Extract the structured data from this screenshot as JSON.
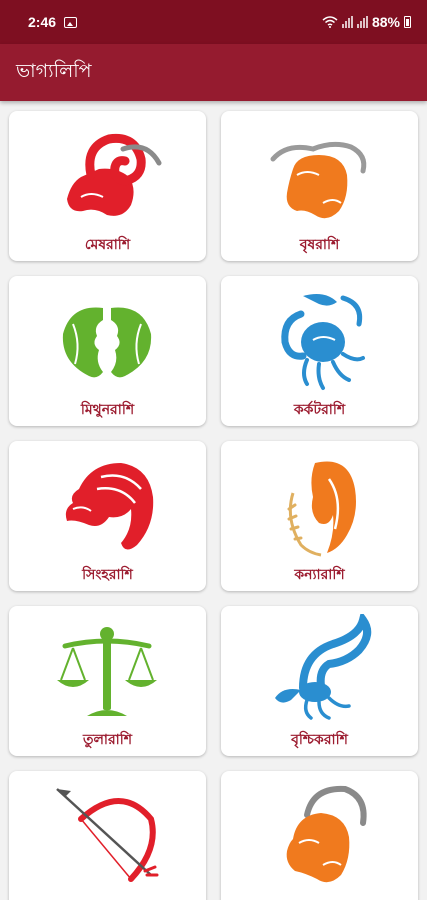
{
  "status_bar": {
    "time": "2:46",
    "battery": "88%",
    "icons": [
      "image-icon",
      "wifi-icon",
      "signal-icon",
      "signal-icon",
      "battery-icon"
    ]
  },
  "app_bar": {
    "title": "ভাগ্যলিপি"
  },
  "zodiac": [
    {
      "label": "মেষরাশি",
      "icon": "aries-ram-icon",
      "color": "#e11f2a"
    },
    {
      "label": "বৃষরাশি",
      "icon": "taurus-bull-icon",
      "color": "#f07a1e"
    },
    {
      "label": "মিথুনরাশি",
      "icon": "gemini-twins-icon",
      "color": "#63b22e"
    },
    {
      "label": "কর্কটরাশি",
      "icon": "cancer-crab-icon",
      "color": "#2a8ed0"
    },
    {
      "label": "সিংহরাশি",
      "icon": "leo-lion-icon",
      "color": "#e11f2a"
    },
    {
      "label": "কন্যারাশি",
      "icon": "virgo-maiden-icon",
      "color": "#f07a1e"
    },
    {
      "label": "তুলারাশি",
      "icon": "libra-scales-icon",
      "color": "#63b22e"
    },
    {
      "label": "বৃশ্চিকরাশি",
      "icon": "scorpio-scorpion-icon",
      "color": "#2a8ed0"
    },
    {
      "label": "",
      "icon": "sagittarius-bow-icon",
      "color": "#e11f2a"
    },
    {
      "label": "",
      "icon": "capricorn-goat-icon",
      "color": "#f07a1e"
    }
  ]
}
